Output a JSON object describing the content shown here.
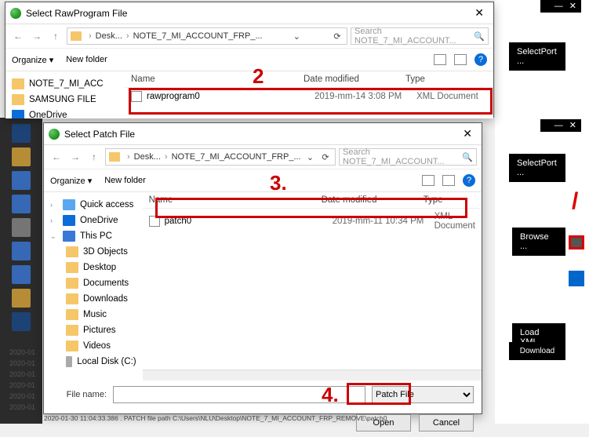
{
  "app_panel": {
    "minimize": "—",
    "close": "✕",
    "select_port": "SelectPort ...",
    "browse": "Browse ...",
    "load_xml": "Load XML ...",
    "download": "Download"
  },
  "dates_strip": [
    "2020-01",
    "2020-01",
    "2020-01",
    "2020-01",
    "2020-01",
    "2020-01"
  ],
  "dialog1": {
    "title": "Select RawProgram File",
    "crumb1": "Desk...",
    "crumb2": "NOTE_7_MI_ACCOUNT_FRP_...",
    "search_placeholder": "Search NOTE_7_MI_ACCOUNT...",
    "organize": "Organize ▾",
    "new_folder": "New folder",
    "col_name": "Name",
    "col_date": "Date modified",
    "col_type": "Type",
    "nav_items": [
      "NOTE_7_MI_ACC",
      "SAMSUNG FILE",
      "OneDrive"
    ],
    "file": {
      "name": "rawprogram0",
      "date": "2019-mm-14 3:08 PM",
      "type": "XML Document"
    }
  },
  "dialog2": {
    "title": "Select Patch File",
    "crumb1": "Desk...",
    "crumb2": "NOTE_7_MI_ACCOUNT_FRP_...",
    "search_placeholder": "Search NOTE_7_MI_ACCOUNT...",
    "organize": "Organize ▾",
    "new_folder": "New folder",
    "col_name": "Name",
    "col_date": "Date modified",
    "col_type": "Type",
    "nav": {
      "quick": "Quick access",
      "onedrive": "OneDrive",
      "thispc": "This PC",
      "children": [
        "3D Objects",
        "Desktop",
        "Documents",
        "Downloads",
        "Music",
        "Pictures",
        "Videos"
      ],
      "localdisk": "Local Disk (C:)"
    },
    "file": {
      "name": "patch0",
      "date": "2019-mm-11 10:34 PM",
      "type": "XML Document"
    },
    "filename_label": "File name:",
    "filter": "Patch File",
    "open": "Open",
    "cancel": "Cancel"
  },
  "annotations": {
    "two": "2",
    "three": "3.",
    "four": "4."
  },
  "bottom_log": "2020-01-30 11:04:33.386 . PATCH file path C:\\Users\\NLU\\Desktop\\NOTE_7_MI_ACCOUNT_FRP_REMOVE\\patch0"
}
